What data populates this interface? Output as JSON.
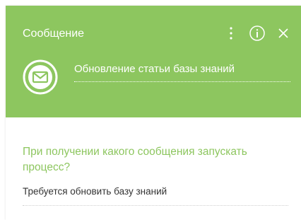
{
  "header": {
    "title": "Сообщение",
    "message_icon": "envelope-icon",
    "message_name": "Обновление статьи базы знаний",
    "actions": [
      {
        "icon": "kebab-menu-icon"
      },
      {
        "icon": "info-icon"
      },
      {
        "icon": "close-icon"
      }
    ]
  },
  "body": {
    "question": "При получении какого сообщения запускать процесс?",
    "answer_value": "Требуется обновить базу знаний"
  },
  "colors": {
    "accent": "#8dc65f",
    "header_text": "#ffffff",
    "body_text": "#333333"
  }
}
